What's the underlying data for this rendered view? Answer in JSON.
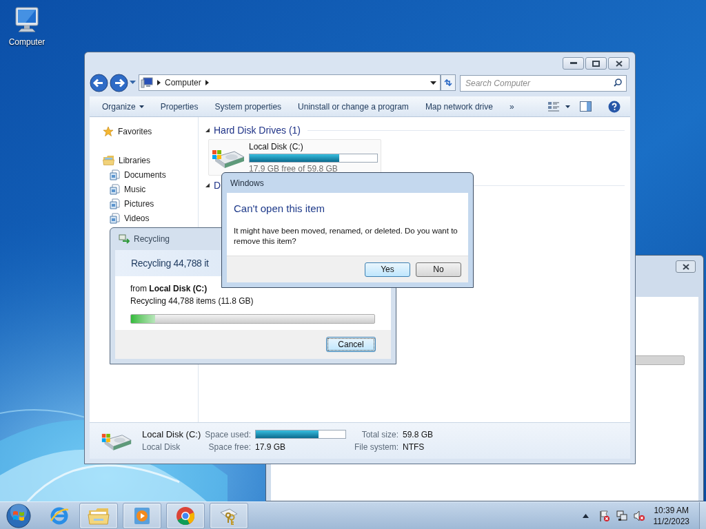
{
  "desktop_icons": [
    {
      "label": "Computer"
    }
  ],
  "explorer": {
    "address": {
      "path": "Computer"
    },
    "search": {
      "placeholder": "Search Computer"
    },
    "toolbar": [
      {
        "label": "Organize",
        "menu": true
      },
      {
        "label": "Properties",
        "menu": false
      },
      {
        "label": "System properties",
        "menu": false
      },
      {
        "label": "Uninstall or change a program",
        "menu": false
      },
      {
        "label": "Map network drive",
        "menu": false
      },
      {
        "label": "»",
        "menu": false
      }
    ],
    "nav": [
      {
        "label": "Favorites",
        "kind": "favorites"
      },
      {
        "label": "Libraries",
        "kind": "libraries",
        "children": [
          {
            "label": "Documents"
          },
          {
            "label": "Music"
          },
          {
            "label": "Pictures"
          },
          {
            "label": "Videos"
          }
        ]
      }
    ],
    "sections": [
      {
        "title": "Hard Disk Drives (1)",
        "expanded": true,
        "drives": [
          {
            "name": "Local Disk (C:)",
            "level": 0.7,
            "free": "17.9 GB free of 59.8 GB"
          }
        ]
      },
      {
        "title": "D",
        "expanded": true
      }
    ],
    "details": {
      "name": "Local Disk (C:)",
      "type": "Local Disk",
      "used_label": "Space used:",
      "level": 0.7,
      "free_label": "Space free:",
      "free": "17.9 GB",
      "total_label": "Total size:",
      "total": "59.8 GB",
      "fs_label": "File system:",
      "fs": "NTFS"
    }
  },
  "recycling": {
    "title": "Recycling",
    "heading": "Recycling 44,788 it",
    "from": "from **Local Disk (C:)**",
    "detail": "Recycling 44,788 items (11.8 GB)",
    "level": 0.1,
    "button": "Cancel"
  },
  "message": {
    "title": "Windows",
    "heading": "Can't open this item",
    "text": "It might have been moved, renamed, or deleted. Do you want to remove this item?",
    "buttons": [
      {
        "label": "Yes",
        "default": true
      },
      {
        "label": "No",
        "default": false
      }
    ]
  },
  "taskbar": {
    "apps": [
      {
        "kind": "ie",
        "running": false
      },
      {
        "kind": "folder",
        "running": true
      },
      {
        "kind": "media",
        "running": true
      },
      {
        "kind": "chrome",
        "running": true
      },
      {
        "kind": "keys",
        "running": true
      }
    ],
    "time": "10:39 AM",
    "date": "11/2/2023"
  }
}
